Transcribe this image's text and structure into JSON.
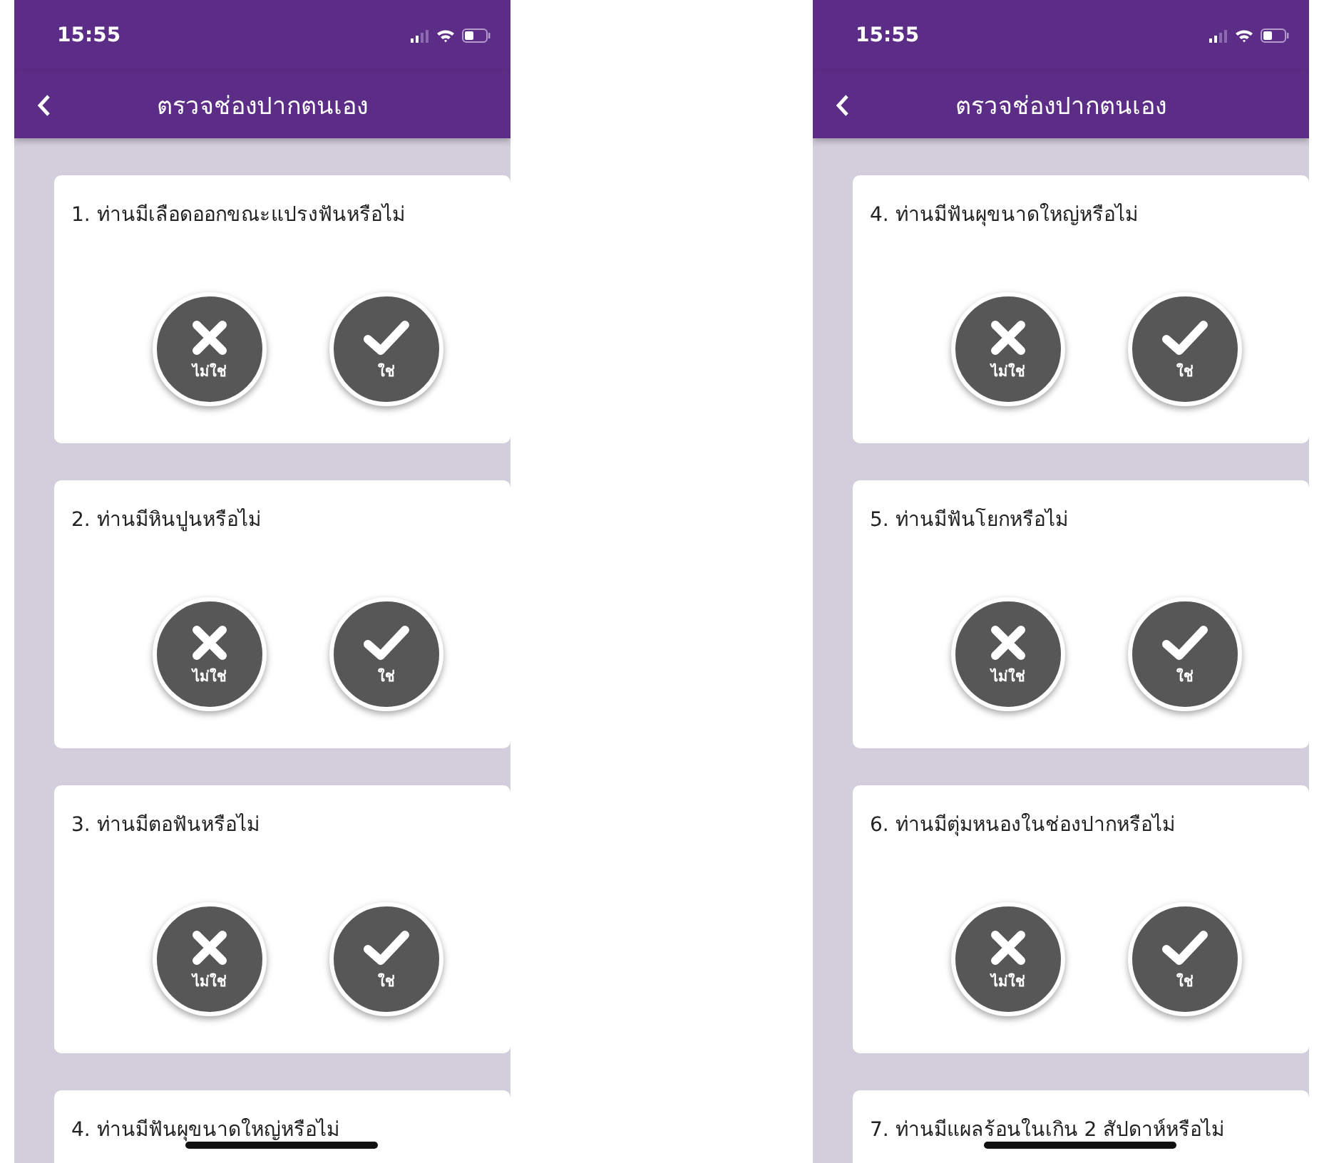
{
  "screens": [
    {
      "status_bar": {
        "time": "15:55"
      },
      "header": {
        "title": "ตรวจช่องปากตนเอง"
      },
      "questions": [
        {
          "text": "1. ท่านมีเลือดออกขณะแปรงฟันหรือไม่",
          "options": [
            {
              "kind": "no",
              "label": "ไม่ใช่"
            },
            {
              "kind": "yes",
              "label": "ใช่"
            }
          ]
        },
        {
          "text": "2. ท่านมีหินปูนหรือไม่",
          "options": [
            {
              "kind": "no",
              "label": "ไม่ใช่"
            },
            {
              "kind": "yes",
              "label": "ใช่"
            }
          ]
        },
        {
          "text": "3. ท่านมีตอฟันหรือไม่",
          "options": [
            {
              "kind": "no",
              "label": "ไม่ใช่"
            },
            {
              "kind": "yes",
              "label": "ใช่"
            }
          ]
        },
        {
          "text": "4. ท่านมีฟันผุขนาดใหญ่หรือไม่"
        }
      ]
    },
    {
      "status_bar": {
        "time": "15:55"
      },
      "header": {
        "title": "ตรวจช่องปากตนเอง"
      },
      "questions": [
        {
          "text": "4. ท่านมีฟันผุขนาดใหญ่หรือไม่",
          "options": [
            {
              "kind": "no",
              "label": "ไม่ใช่"
            },
            {
              "kind": "yes",
              "label": "ใช่"
            }
          ]
        },
        {
          "text": "5. ท่านมีฟันโยกหรือไม่",
          "options": [
            {
              "kind": "no",
              "label": "ไม่ใช่"
            },
            {
              "kind": "yes",
              "label": "ใช่"
            }
          ]
        },
        {
          "text": "6. ท่านมีตุ่มหนองในช่องปากหรือไม่",
          "options": [
            {
              "kind": "no",
              "label": "ไม่ใช่"
            },
            {
              "kind": "yes",
              "label": "ใช่"
            }
          ]
        },
        {
          "text": "7. ท่านมีแผลร้อนในเกิน 2 สัปดาห์หรือไม่"
        }
      ]
    }
  ]
}
